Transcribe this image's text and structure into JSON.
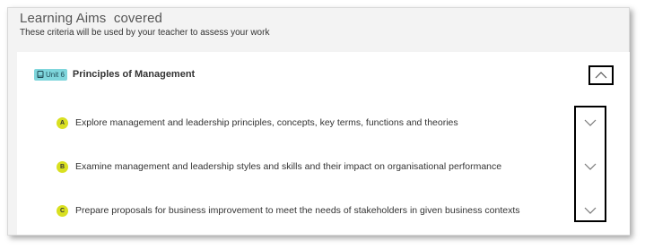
{
  "header": {
    "title": "Learning Aims  covered",
    "subtitle": "These criteria will be used by your teacher to assess your work"
  },
  "unit": {
    "badge_label": "Unit 6",
    "title": "Principles of Management",
    "badge_color": "#7fd6dc",
    "badge_icon": "book-icon",
    "collapse_icon": "chevron-up-icon"
  },
  "aims": [
    {
      "letter": "A",
      "text": "Explore management and leadership principles, concepts, key terms, functions and theories",
      "icon": "chevron-down-icon"
    },
    {
      "letter": "B",
      "text": "Examine management and leadership styles and skills and their impact on organisational performance",
      "icon": "chevron-down-icon"
    },
    {
      "letter": "C",
      "text": "Prepare proposals for business improvement to meet the needs of stakeholders in given business contexts",
      "icon": "chevron-down-icon"
    }
  ],
  "colors": {
    "aim_letter_bg": "#d9e021",
    "panel_bg": "#f3f3f3"
  }
}
